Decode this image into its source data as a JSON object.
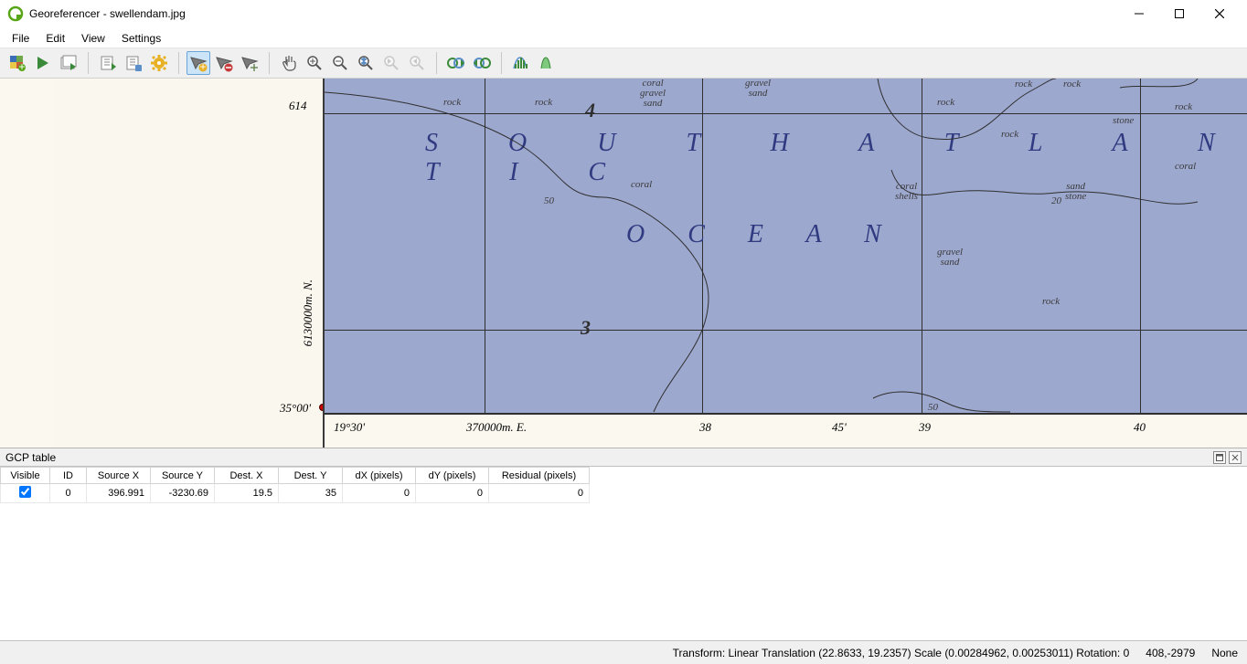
{
  "window": {
    "title": "Georeferencer - swellendam.jpg"
  },
  "menu": {
    "file": "File",
    "edit": "Edit",
    "view": "View",
    "settings": "Settings"
  },
  "panel": {
    "title": "GCP table"
  },
  "table": {
    "headers": [
      "Visible",
      "ID",
      "Source X",
      "Source Y",
      "Dest. X",
      "Dest. Y",
      "dX (pixels)",
      "dY (pixels)",
      "Residual (pixels)"
    ],
    "row": {
      "id": "0",
      "srcx": "396.991",
      "srcy": "-3230.69",
      "destx": "19.5",
      "desty": "35",
      "dx": "0",
      "dy": "0",
      "res": "0"
    }
  },
  "status": {
    "transform": "Transform: Linear Translation (22.8633, 19.2357) Scale (0.00284962, 0.00253011) Rotation: 0",
    "coords": "408,-2979",
    "extra": "None"
  },
  "map": {
    "title1": "S O U T H   A T L A N T I C",
    "title2": "O   C   E   A   N",
    "g614": "614",
    "g4": "4",
    "g3": "3",
    "lat35": "35°00'",
    "lon1930": "19°30'",
    "meE": "370000m. E.",
    "meN": "6130000m. N.",
    "x38": "38",
    "x45": "45'",
    "x39": "39",
    "x40": "40",
    "ann_rock": "rock",
    "ann_coral": "coral",
    "ann_coral_gravel_sand": "coral\ngravel\nsand",
    "ann_gravel_sand": "gravel\nsand",
    "ann_sand_stone": "sand\nstone",
    "ann_coral_shells": "coral\nshells",
    "ann_stone": "stone",
    "iso50": "50",
    "iso20": "20"
  }
}
